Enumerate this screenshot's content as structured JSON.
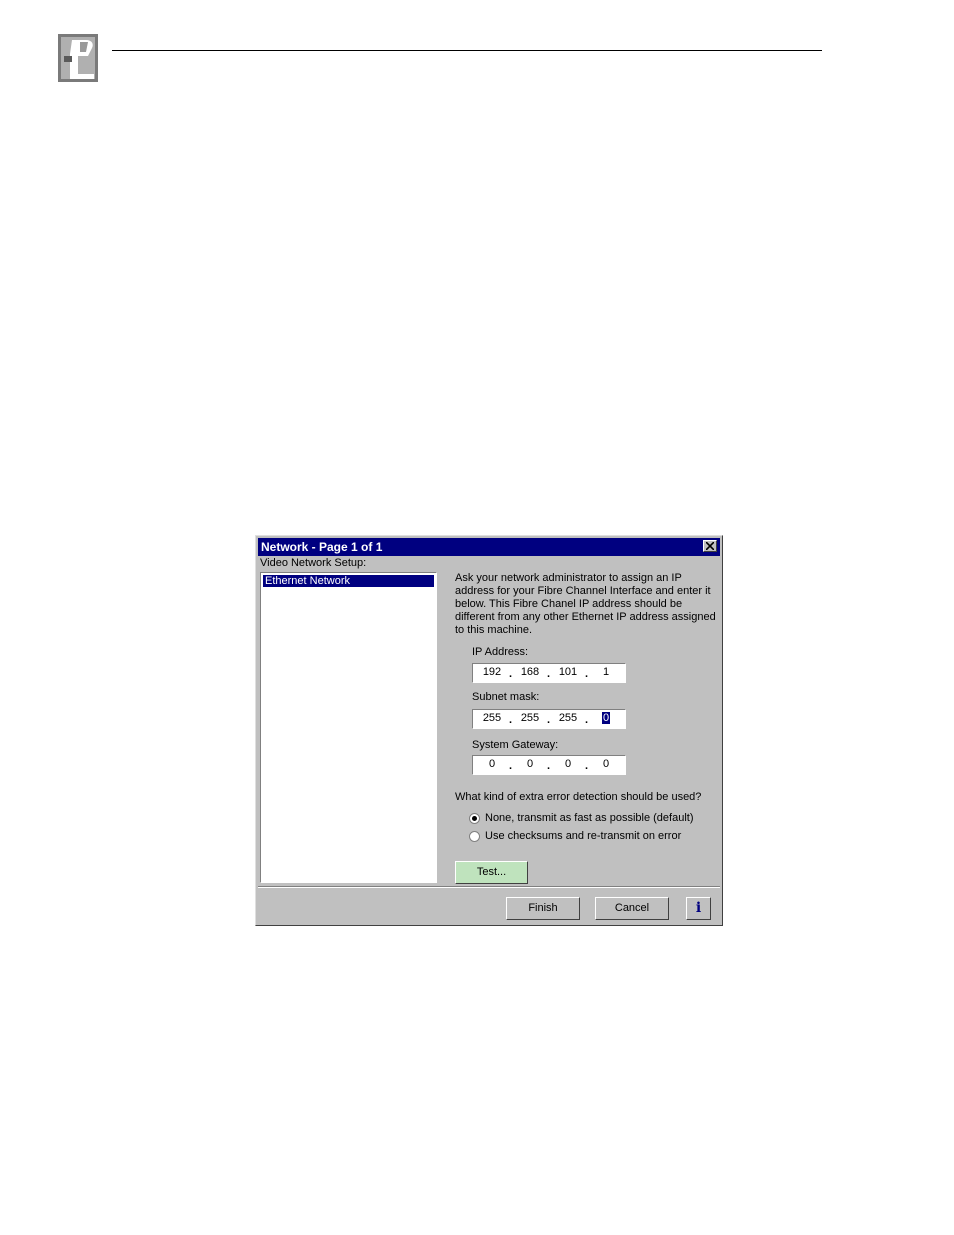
{
  "dialog": {
    "title": "Network - Page 1 of 1",
    "setup_label": "Video Network Setup:",
    "list_items": [
      "Ethernet Network"
    ],
    "info_text": "Ask your network administrator to assign an IP address for your Fibre Channel Interface and enter it below. This Fibre Chanel IP address should be different from any other Ethernet IP address assigned to this machine.",
    "ip": {
      "label": "IP Address:",
      "octets": [
        "192",
        "168",
        "101",
        "1"
      ]
    },
    "subnet": {
      "label": "Subnet mask:",
      "octets": [
        "255",
        "255",
        "255",
        "0"
      ]
    },
    "gateway": {
      "label": "System Gateway:",
      "octets": [
        "0",
        "0",
        "0",
        "0"
      ]
    },
    "dot": ".",
    "error_question": "What kind of extra error detection should be used?",
    "radio_options": [
      "None, transmit as fast as possible (default)",
      "Use checksums and re-transmit on error"
    ],
    "selected_radio": 0,
    "test_label": "Test...",
    "finish_label": "Finish",
    "cancel_label": "Cancel",
    "info_button": "i"
  },
  "icons": {
    "logo": "pvs-logo-icon",
    "close": "close-icon"
  },
  "colors": {
    "titlebar": "#000080",
    "face": "#c0c0c0",
    "test_button": "#bfe3bd"
  }
}
